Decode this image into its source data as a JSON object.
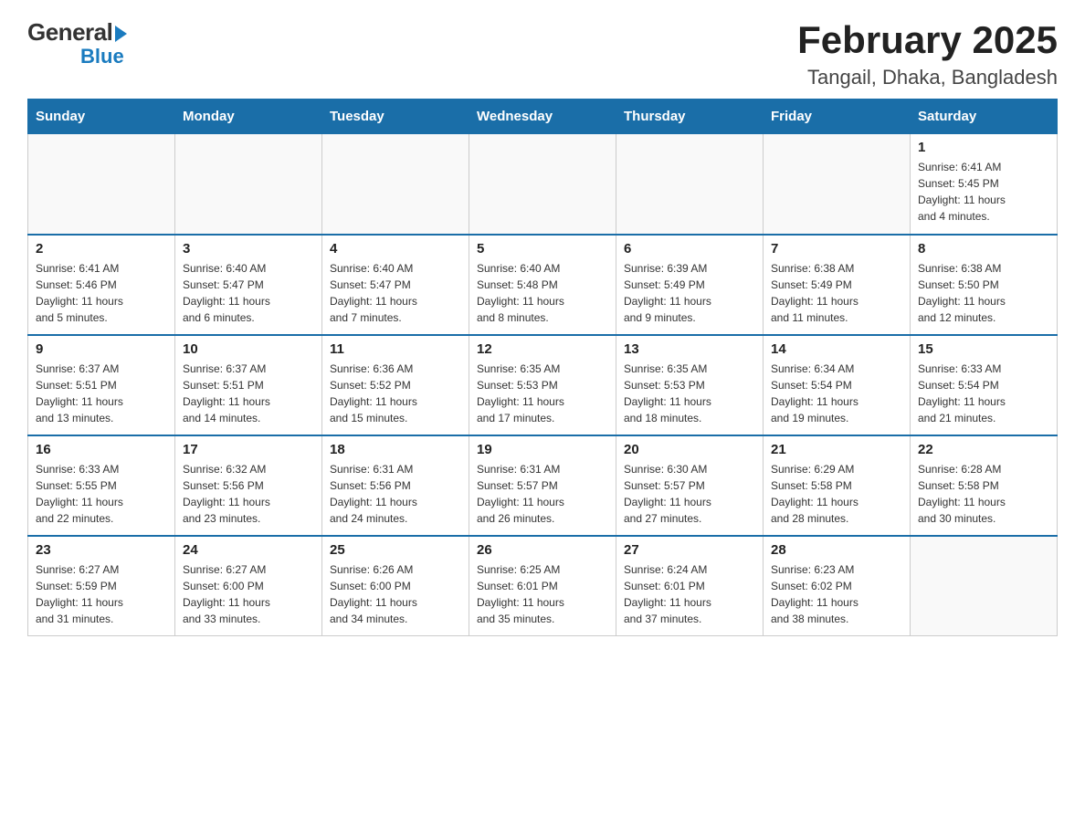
{
  "logo": {
    "general": "General",
    "blue": "Blue",
    "arrow": "▶"
  },
  "title": "February 2025",
  "subtitle": "Tangail, Dhaka, Bangladesh",
  "weekdays": [
    "Sunday",
    "Monday",
    "Tuesday",
    "Wednesday",
    "Thursday",
    "Friday",
    "Saturday"
  ],
  "weeks": [
    [
      {
        "day": "",
        "info": ""
      },
      {
        "day": "",
        "info": ""
      },
      {
        "day": "",
        "info": ""
      },
      {
        "day": "",
        "info": ""
      },
      {
        "day": "",
        "info": ""
      },
      {
        "day": "",
        "info": ""
      },
      {
        "day": "1",
        "info": "Sunrise: 6:41 AM\nSunset: 5:45 PM\nDaylight: 11 hours\nand 4 minutes."
      }
    ],
    [
      {
        "day": "2",
        "info": "Sunrise: 6:41 AM\nSunset: 5:46 PM\nDaylight: 11 hours\nand 5 minutes."
      },
      {
        "day": "3",
        "info": "Sunrise: 6:40 AM\nSunset: 5:47 PM\nDaylight: 11 hours\nand 6 minutes."
      },
      {
        "day": "4",
        "info": "Sunrise: 6:40 AM\nSunset: 5:47 PM\nDaylight: 11 hours\nand 7 minutes."
      },
      {
        "day": "5",
        "info": "Sunrise: 6:40 AM\nSunset: 5:48 PM\nDaylight: 11 hours\nand 8 minutes."
      },
      {
        "day": "6",
        "info": "Sunrise: 6:39 AM\nSunset: 5:49 PM\nDaylight: 11 hours\nand 9 minutes."
      },
      {
        "day": "7",
        "info": "Sunrise: 6:38 AM\nSunset: 5:49 PM\nDaylight: 11 hours\nand 11 minutes."
      },
      {
        "day": "8",
        "info": "Sunrise: 6:38 AM\nSunset: 5:50 PM\nDaylight: 11 hours\nand 12 minutes."
      }
    ],
    [
      {
        "day": "9",
        "info": "Sunrise: 6:37 AM\nSunset: 5:51 PM\nDaylight: 11 hours\nand 13 minutes."
      },
      {
        "day": "10",
        "info": "Sunrise: 6:37 AM\nSunset: 5:51 PM\nDaylight: 11 hours\nand 14 minutes."
      },
      {
        "day": "11",
        "info": "Sunrise: 6:36 AM\nSunset: 5:52 PM\nDaylight: 11 hours\nand 15 minutes."
      },
      {
        "day": "12",
        "info": "Sunrise: 6:35 AM\nSunset: 5:53 PM\nDaylight: 11 hours\nand 17 minutes."
      },
      {
        "day": "13",
        "info": "Sunrise: 6:35 AM\nSunset: 5:53 PM\nDaylight: 11 hours\nand 18 minutes."
      },
      {
        "day": "14",
        "info": "Sunrise: 6:34 AM\nSunset: 5:54 PM\nDaylight: 11 hours\nand 19 minutes."
      },
      {
        "day": "15",
        "info": "Sunrise: 6:33 AM\nSunset: 5:54 PM\nDaylight: 11 hours\nand 21 minutes."
      }
    ],
    [
      {
        "day": "16",
        "info": "Sunrise: 6:33 AM\nSunset: 5:55 PM\nDaylight: 11 hours\nand 22 minutes."
      },
      {
        "day": "17",
        "info": "Sunrise: 6:32 AM\nSunset: 5:56 PM\nDaylight: 11 hours\nand 23 minutes."
      },
      {
        "day": "18",
        "info": "Sunrise: 6:31 AM\nSunset: 5:56 PM\nDaylight: 11 hours\nand 24 minutes."
      },
      {
        "day": "19",
        "info": "Sunrise: 6:31 AM\nSunset: 5:57 PM\nDaylight: 11 hours\nand 26 minutes."
      },
      {
        "day": "20",
        "info": "Sunrise: 6:30 AM\nSunset: 5:57 PM\nDaylight: 11 hours\nand 27 minutes."
      },
      {
        "day": "21",
        "info": "Sunrise: 6:29 AM\nSunset: 5:58 PM\nDaylight: 11 hours\nand 28 minutes."
      },
      {
        "day": "22",
        "info": "Sunrise: 6:28 AM\nSunset: 5:58 PM\nDaylight: 11 hours\nand 30 minutes."
      }
    ],
    [
      {
        "day": "23",
        "info": "Sunrise: 6:27 AM\nSunset: 5:59 PM\nDaylight: 11 hours\nand 31 minutes."
      },
      {
        "day": "24",
        "info": "Sunrise: 6:27 AM\nSunset: 6:00 PM\nDaylight: 11 hours\nand 33 minutes."
      },
      {
        "day": "25",
        "info": "Sunrise: 6:26 AM\nSunset: 6:00 PM\nDaylight: 11 hours\nand 34 minutes."
      },
      {
        "day": "26",
        "info": "Sunrise: 6:25 AM\nSunset: 6:01 PM\nDaylight: 11 hours\nand 35 minutes."
      },
      {
        "day": "27",
        "info": "Sunrise: 6:24 AM\nSunset: 6:01 PM\nDaylight: 11 hours\nand 37 minutes."
      },
      {
        "day": "28",
        "info": "Sunrise: 6:23 AM\nSunset: 6:02 PM\nDaylight: 11 hours\nand 38 minutes."
      },
      {
        "day": "",
        "info": ""
      }
    ]
  ]
}
